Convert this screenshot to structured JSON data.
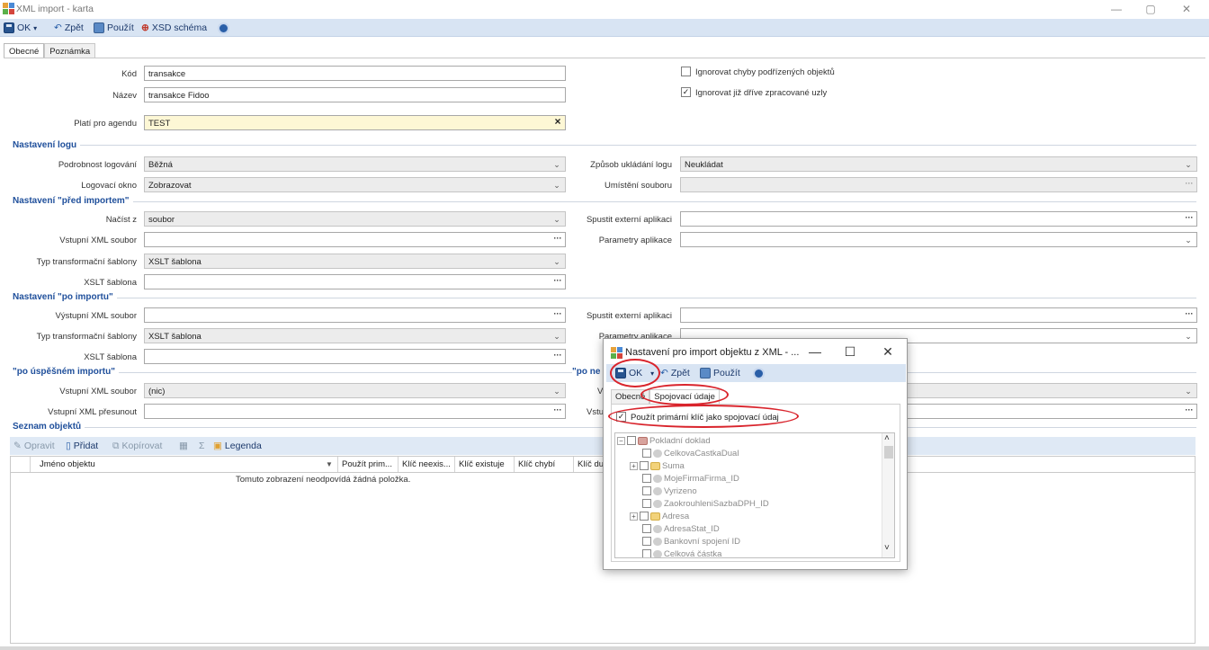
{
  "window": {
    "title": "XML import - karta",
    "controls": {
      "minimize": "—",
      "maximize": "▢",
      "close": "✕"
    }
  },
  "toolbar": {
    "ok": "OK",
    "ok_arrow": "▾",
    "undo": "Zpět",
    "apply": "Použít",
    "xsd": "XSD schéma"
  },
  "tabs": [
    "Obecné",
    "Poznámka"
  ],
  "fields": {
    "kod": {
      "label": "Kód",
      "value": "transakce"
    },
    "nazev": {
      "label": "Název",
      "value": "transakce Fidoo"
    },
    "agenda": {
      "label": "Platí pro agendu",
      "value": "TEST",
      "clear": "×"
    }
  },
  "checks": {
    "ignore_child_errors": {
      "label": "Ignorovat chyby podřízených objektů",
      "checked": false
    },
    "ignore_processed": {
      "label": "Ignorovat již dříve zpracované uzly",
      "checked": true,
      "mark": "✓"
    }
  },
  "log": {
    "section": "Nastavení logu",
    "detail_label": "Podrobnost logování",
    "detail_value": "Běžná",
    "window_label": "Logovací okno",
    "window_value": "Zobrazovat",
    "save_mode_label": "Způsob ukládání logu",
    "save_mode_value": "Neukládat",
    "file_location_label": "Umístění souboru",
    "file_location_value": ""
  },
  "pre": {
    "section": "Nastavení \"před importem\"",
    "load_label": "Načíst z",
    "load_value": "soubor",
    "input_label": "Vstupní XML soubor",
    "input_value": "",
    "template_type_label": "Typ transformační šablony",
    "template_type_value": "XSLT šablona",
    "xslt_label": "XSLT šablona",
    "xslt_value": "",
    "ext_app_label": "Spustit externí aplikaci",
    "ext_app_value": "",
    "app_params_label": "Parametry aplikace",
    "app_params_value": ""
  },
  "post": {
    "section": "Nastavení \"po importu\"",
    "output_label": "Výstupní XML soubor",
    "output_value": "",
    "template_type_label": "Typ transformační šablony",
    "template_type_value": "XSLT šablona",
    "xslt_label": "XSLT šablona",
    "xslt_value": "",
    "ext_app_label": "Spustit externí aplikaci",
    "ext_app_value": "",
    "app_params_label": "Parametry aplikace",
    "app_params_value": ""
  },
  "success": {
    "section": "\"po úspěšném importu\"",
    "section_right": "\"po ne",
    "input_label": "Vstupní XML soubor",
    "input_value": "(nic)",
    "move_label": "Vstupní XML přesunout",
    "move_value": "",
    "right_label_1": "V",
    "right_label_2": "Vstu"
  },
  "objects": {
    "section": "Seznam objektů",
    "toolbar": {
      "edit": "Opravit",
      "add": "Přidat",
      "copy": "Kopírovat",
      "sum": "Σ",
      "legend": "Legenda"
    },
    "columns": [
      "Jméno objektu",
      "Použít prim...",
      "Klíč neexis...",
      "Klíč existuje",
      "Klíč chybí",
      "Klíč du"
    ],
    "empty": "Tomuto zobrazení neodpovídá žádná položka."
  },
  "dialog": {
    "title": "Nastavení pro import objektu z XML - ...",
    "controls": {
      "minimize": "—",
      "maximize": "☐",
      "close": "✕"
    },
    "toolbar": {
      "ok": "OK",
      "ok_arrow": "▾",
      "undo": "Zpět",
      "apply": "Použít"
    },
    "tabs": [
      "Obecné",
      "Spojovací údaje"
    ],
    "use_pk": {
      "label": "Použít primární klíč jako spojovací údaj",
      "checked": true,
      "mark": "✓"
    },
    "tree": [
      {
        "label": "Pokladní doklad",
        "kind": "doc",
        "expander": "−"
      },
      {
        "label": "CelkovaCastkaDual",
        "kind": "field"
      },
      {
        "label": "Suma",
        "kind": "folder",
        "expander": "+"
      },
      {
        "label": "MojeFirmaFirma_ID",
        "kind": "field"
      },
      {
        "label": "Vyrizeno",
        "kind": "field"
      },
      {
        "label": "ZaokrouhleniSazbaDPH_ID",
        "kind": "field"
      },
      {
        "label": "Adresa",
        "kind": "folder",
        "expander": "+"
      },
      {
        "label": "AdresaStat_ID",
        "kind": "field"
      },
      {
        "label": "Bankovní spojení ID",
        "kind": "field"
      },
      {
        "label": "Celková částka",
        "kind": "field"
      }
    ]
  },
  "icons": {
    "dropdown": "⌄",
    "ellipsis": "···",
    "scroll_up": "˄",
    "scroll_down": "˅"
  }
}
